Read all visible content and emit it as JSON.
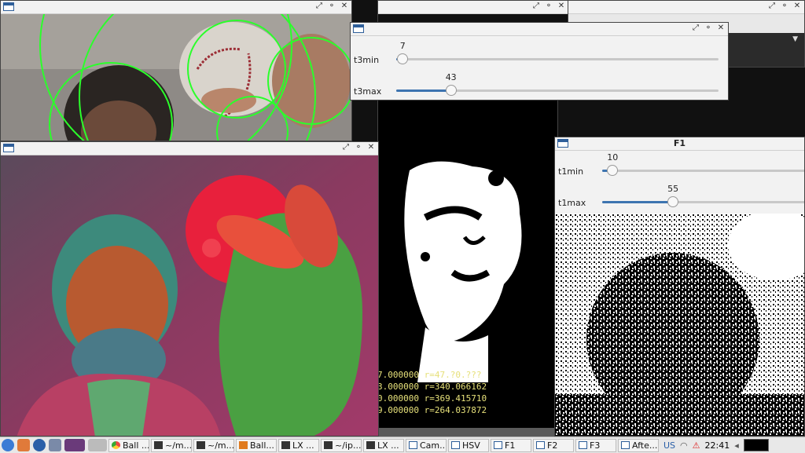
{
  "windows": {
    "camera": {
      "controls": [
        "⤢",
        "⚬",
        "✕"
      ]
    },
    "hsv": {
      "controls": [
        "⤢",
        "⚬",
        "✕"
      ]
    },
    "topright_a": {
      "controls": [
        "⤢",
        "⚬",
        "✕"
      ]
    },
    "topright_b": {
      "controls": [
        "⤢",
        "⚬",
        "✕"
      ]
    },
    "f3_panel": {
      "controls": [
        "⤢",
        "⚬",
        "✕"
      ]
    },
    "f1": {
      "title": "F1"
    }
  },
  "t3": {
    "min": {
      "label": "t3min",
      "value": "7",
      "fraction": 0.02
    },
    "max": {
      "label": "t3max",
      "value": "43",
      "fraction": 0.17
    }
  },
  "t1": {
    "min": {
      "label": "t1min",
      "value": "10",
      "fraction": 0.05
    },
    "max": {
      "label": "t1max",
      "value": "55",
      "fraction": 0.34
    }
  },
  "terminal": {
    "lines": [
      "7.000000 r=47.?0.???",
      "3.000000 r=340.066162",
      "0.000000 r=369.415710",
      "9.000000 r=264.037872"
    ]
  },
  "taskbar": {
    "items": [
      "Ball ...",
      "~/m...",
      "~/m...",
      "Ball...",
      "LX ...",
      "~/ip...",
      "LX ...",
      "Cam...",
      "HSV",
      "F1",
      "F2",
      "F3",
      "Afte..."
    ],
    "keyboard": "US",
    "clock": "22:41"
  }
}
